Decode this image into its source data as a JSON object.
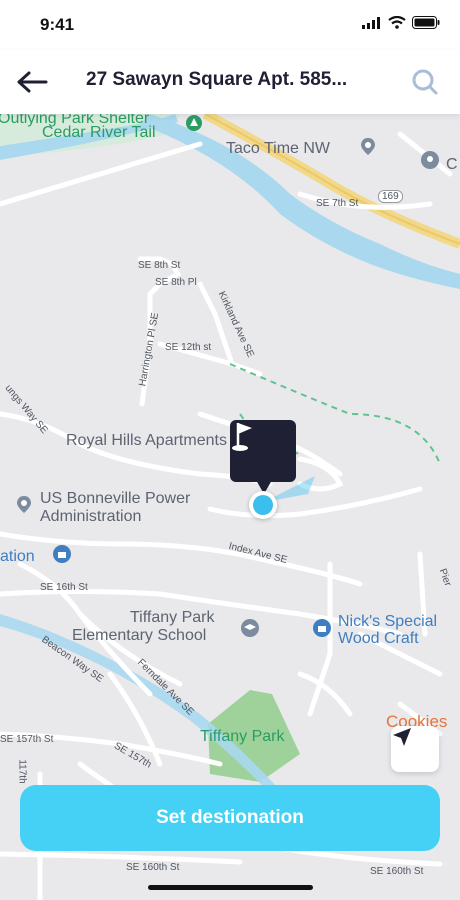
{
  "status_bar": {
    "time": "9:41"
  },
  "header": {
    "title": "27 Sawayn Square Apt. 585..."
  },
  "map": {
    "labels": {
      "outlying_park": "Outlying Park Shelter",
      "cedar_river": "Cedar River Tail",
      "taco_time": "Taco Time NW",
      "c_partial": "C",
      "se_7th": "SE 7th St",
      "hwy_169": "169",
      "se_8th_st": "SE 8th St",
      "se_8th_pl": "SE 8th Pl",
      "kirkland": "Kirkland Ave SE",
      "harrington": "Harrington Pl SE",
      "se_12th": "SE 12th st",
      "royal_hills": "Royal Hills Apartments",
      "us_bpa_1": "US Bonneville Power",
      "us_bpa_2": "Administration",
      "ation": "ation",
      "index_ave": "Index Ave SE",
      "se_16th": "SE 16th St",
      "tiffany_school_1": "Tiffany Park",
      "tiffany_school_2": "Elementary School",
      "nicks_1": "Nick's Special",
      "nicks_2": "Wood Craft",
      "beacon_way": "Beacon Way SE",
      "ferndale": "Ferndale Ave SE",
      "se_157th": "SE 157th St",
      "se_157th_2": "SE 157th",
      "tiffany_park": "Tiffany Park",
      "cookies": "Cookies",
      "se_160th": "SE 160th St",
      "se_160th_2": "SE 160th St",
      "ungs_way": "ungs Way SE",
      "pier": "Pier",
      "th_117": "117th"
    }
  },
  "actions": {
    "set_destination": "Set destionation"
  }
}
